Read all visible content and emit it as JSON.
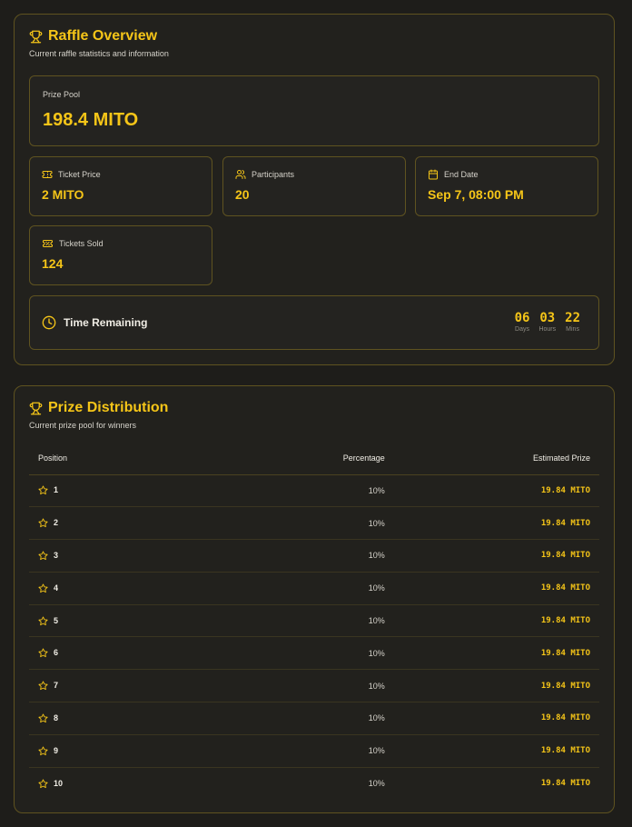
{
  "overview": {
    "title": "Raffle Overview",
    "subtitle": "Current raffle statistics and information",
    "prize_pool": {
      "label": "Prize Pool",
      "value": "198.4 MITO"
    },
    "ticket_price": {
      "label": "Ticket Price",
      "value": "2 MITO"
    },
    "participants": {
      "label": "Participants",
      "value": "20"
    },
    "end_date": {
      "label": "End Date",
      "value": "Sep 7, 08:00 PM"
    },
    "tickets_sold": {
      "label": "Tickets Sold",
      "value": "124"
    },
    "time_remaining": {
      "label": "Time Remaining",
      "days": "06",
      "days_label": "Days",
      "hours": "03",
      "hours_label": "Hours",
      "mins": "22",
      "mins_label": "Mins"
    }
  },
  "distribution": {
    "title": "Prize Distribution",
    "subtitle": "Current prize pool for winners",
    "headers": {
      "position": "Position",
      "percentage": "Percentage",
      "estimated": "Estimated Prize"
    },
    "rows": [
      {
        "position": "1",
        "percentage": "10%",
        "prize": "19.84 MITO"
      },
      {
        "position": "2",
        "percentage": "10%",
        "prize": "19.84 MITO"
      },
      {
        "position": "3",
        "percentage": "10%",
        "prize": "19.84 MITO"
      },
      {
        "position": "4",
        "percentage": "10%",
        "prize": "19.84 MITO"
      },
      {
        "position": "5",
        "percentage": "10%",
        "prize": "19.84 MITO"
      },
      {
        "position": "6",
        "percentage": "10%",
        "prize": "19.84 MITO"
      },
      {
        "position": "7",
        "percentage": "10%",
        "prize": "19.84 MITO"
      },
      {
        "position": "8",
        "percentage": "10%",
        "prize": "19.84 MITO"
      },
      {
        "position": "9",
        "percentage": "10%",
        "prize": "19.84 MITO"
      },
      {
        "position": "10",
        "percentage": "10%",
        "prize": "19.84 MITO"
      }
    ]
  },
  "colors": {
    "accent": "#f5c518",
    "border": "#5f5320",
    "background": "#1e1d1a"
  },
  "icons": [
    "trophy-icon",
    "ticket-icon",
    "users-icon",
    "calendar-icon",
    "clock-icon",
    "star-icon"
  ]
}
